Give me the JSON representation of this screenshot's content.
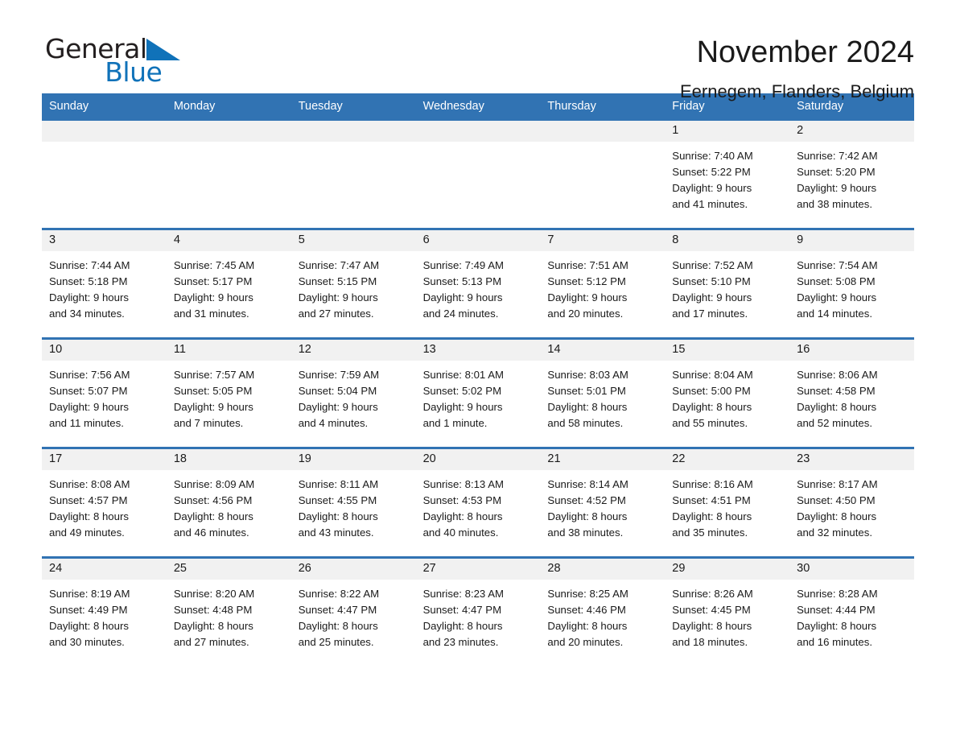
{
  "brand": {
    "name_part1": "General",
    "name_part2": "Blue",
    "accent_color": "#1072b9",
    "triangle_icon": "brand-triangle-icon"
  },
  "header": {
    "title": "November 2024",
    "subtitle": "Eernegem, Flanders, Belgium"
  },
  "calendar": {
    "header_bg": "#3173b3",
    "row_divider_color": "#3173b3",
    "daynum_band_bg": "#f1f1f1",
    "weekdays": [
      "Sunday",
      "Monday",
      "Tuesday",
      "Wednesday",
      "Thursday",
      "Friday",
      "Saturday"
    ],
    "weeks": [
      [
        {
          "day": "",
          "sunrise": "",
          "sunset": "",
          "daylight_line1": "",
          "daylight_line2": ""
        },
        {
          "day": "",
          "sunrise": "",
          "sunset": "",
          "daylight_line1": "",
          "daylight_line2": ""
        },
        {
          "day": "",
          "sunrise": "",
          "sunset": "",
          "daylight_line1": "",
          "daylight_line2": ""
        },
        {
          "day": "",
          "sunrise": "",
          "sunset": "",
          "daylight_line1": "",
          "daylight_line2": ""
        },
        {
          "day": "",
          "sunrise": "",
          "sunset": "",
          "daylight_line1": "",
          "daylight_line2": ""
        },
        {
          "day": "1",
          "sunrise": "Sunrise: 7:40 AM",
          "sunset": "Sunset: 5:22 PM",
          "daylight_line1": "Daylight: 9 hours",
          "daylight_line2": "and 41 minutes."
        },
        {
          "day": "2",
          "sunrise": "Sunrise: 7:42 AM",
          "sunset": "Sunset: 5:20 PM",
          "daylight_line1": "Daylight: 9 hours",
          "daylight_line2": "and 38 minutes."
        }
      ],
      [
        {
          "day": "3",
          "sunrise": "Sunrise: 7:44 AM",
          "sunset": "Sunset: 5:18 PM",
          "daylight_line1": "Daylight: 9 hours",
          "daylight_line2": "and 34 minutes."
        },
        {
          "day": "4",
          "sunrise": "Sunrise: 7:45 AM",
          "sunset": "Sunset: 5:17 PM",
          "daylight_line1": "Daylight: 9 hours",
          "daylight_line2": "and 31 minutes."
        },
        {
          "day": "5",
          "sunrise": "Sunrise: 7:47 AM",
          "sunset": "Sunset: 5:15 PM",
          "daylight_line1": "Daylight: 9 hours",
          "daylight_line2": "and 27 minutes."
        },
        {
          "day": "6",
          "sunrise": "Sunrise: 7:49 AM",
          "sunset": "Sunset: 5:13 PM",
          "daylight_line1": "Daylight: 9 hours",
          "daylight_line2": "and 24 minutes."
        },
        {
          "day": "7",
          "sunrise": "Sunrise: 7:51 AM",
          "sunset": "Sunset: 5:12 PM",
          "daylight_line1": "Daylight: 9 hours",
          "daylight_line2": "and 20 minutes."
        },
        {
          "day": "8",
          "sunrise": "Sunrise: 7:52 AM",
          "sunset": "Sunset: 5:10 PM",
          "daylight_line1": "Daylight: 9 hours",
          "daylight_line2": "and 17 minutes."
        },
        {
          "day": "9",
          "sunrise": "Sunrise: 7:54 AM",
          "sunset": "Sunset: 5:08 PM",
          "daylight_line1": "Daylight: 9 hours",
          "daylight_line2": "and 14 minutes."
        }
      ],
      [
        {
          "day": "10",
          "sunrise": "Sunrise: 7:56 AM",
          "sunset": "Sunset: 5:07 PM",
          "daylight_line1": "Daylight: 9 hours",
          "daylight_line2": "and 11 minutes."
        },
        {
          "day": "11",
          "sunrise": "Sunrise: 7:57 AM",
          "sunset": "Sunset: 5:05 PM",
          "daylight_line1": "Daylight: 9 hours",
          "daylight_line2": "and 7 minutes."
        },
        {
          "day": "12",
          "sunrise": "Sunrise: 7:59 AM",
          "sunset": "Sunset: 5:04 PM",
          "daylight_line1": "Daylight: 9 hours",
          "daylight_line2": "and 4 minutes."
        },
        {
          "day": "13",
          "sunrise": "Sunrise: 8:01 AM",
          "sunset": "Sunset: 5:02 PM",
          "daylight_line1": "Daylight: 9 hours",
          "daylight_line2": "and 1 minute."
        },
        {
          "day": "14",
          "sunrise": "Sunrise: 8:03 AM",
          "sunset": "Sunset: 5:01 PM",
          "daylight_line1": "Daylight: 8 hours",
          "daylight_line2": "and 58 minutes."
        },
        {
          "day": "15",
          "sunrise": "Sunrise: 8:04 AM",
          "sunset": "Sunset: 5:00 PM",
          "daylight_line1": "Daylight: 8 hours",
          "daylight_line2": "and 55 minutes."
        },
        {
          "day": "16",
          "sunrise": "Sunrise: 8:06 AM",
          "sunset": "Sunset: 4:58 PM",
          "daylight_line1": "Daylight: 8 hours",
          "daylight_line2": "and 52 minutes."
        }
      ],
      [
        {
          "day": "17",
          "sunrise": "Sunrise: 8:08 AM",
          "sunset": "Sunset: 4:57 PM",
          "daylight_line1": "Daylight: 8 hours",
          "daylight_line2": "and 49 minutes."
        },
        {
          "day": "18",
          "sunrise": "Sunrise: 8:09 AM",
          "sunset": "Sunset: 4:56 PM",
          "daylight_line1": "Daylight: 8 hours",
          "daylight_line2": "and 46 minutes."
        },
        {
          "day": "19",
          "sunrise": "Sunrise: 8:11 AM",
          "sunset": "Sunset: 4:55 PM",
          "daylight_line1": "Daylight: 8 hours",
          "daylight_line2": "and 43 minutes."
        },
        {
          "day": "20",
          "sunrise": "Sunrise: 8:13 AM",
          "sunset": "Sunset: 4:53 PM",
          "daylight_line1": "Daylight: 8 hours",
          "daylight_line2": "and 40 minutes."
        },
        {
          "day": "21",
          "sunrise": "Sunrise: 8:14 AM",
          "sunset": "Sunset: 4:52 PM",
          "daylight_line1": "Daylight: 8 hours",
          "daylight_line2": "and 38 minutes."
        },
        {
          "day": "22",
          "sunrise": "Sunrise: 8:16 AM",
          "sunset": "Sunset: 4:51 PM",
          "daylight_line1": "Daylight: 8 hours",
          "daylight_line2": "and 35 minutes."
        },
        {
          "day": "23",
          "sunrise": "Sunrise: 8:17 AM",
          "sunset": "Sunset: 4:50 PM",
          "daylight_line1": "Daylight: 8 hours",
          "daylight_line2": "and 32 minutes."
        }
      ],
      [
        {
          "day": "24",
          "sunrise": "Sunrise: 8:19 AM",
          "sunset": "Sunset: 4:49 PM",
          "daylight_line1": "Daylight: 8 hours",
          "daylight_line2": "and 30 minutes."
        },
        {
          "day": "25",
          "sunrise": "Sunrise: 8:20 AM",
          "sunset": "Sunset: 4:48 PM",
          "daylight_line1": "Daylight: 8 hours",
          "daylight_line2": "and 27 minutes."
        },
        {
          "day": "26",
          "sunrise": "Sunrise: 8:22 AM",
          "sunset": "Sunset: 4:47 PM",
          "daylight_line1": "Daylight: 8 hours",
          "daylight_line2": "and 25 minutes."
        },
        {
          "day": "27",
          "sunrise": "Sunrise: 8:23 AM",
          "sunset": "Sunset: 4:47 PM",
          "daylight_line1": "Daylight: 8 hours",
          "daylight_line2": "and 23 minutes."
        },
        {
          "day": "28",
          "sunrise": "Sunrise: 8:25 AM",
          "sunset": "Sunset: 4:46 PM",
          "daylight_line1": "Daylight: 8 hours",
          "daylight_line2": "and 20 minutes."
        },
        {
          "day": "29",
          "sunrise": "Sunrise: 8:26 AM",
          "sunset": "Sunset: 4:45 PM",
          "daylight_line1": "Daylight: 8 hours",
          "daylight_line2": "and 18 minutes."
        },
        {
          "day": "30",
          "sunrise": "Sunrise: 8:28 AM",
          "sunset": "Sunset: 4:44 PM",
          "daylight_line1": "Daylight: 8 hours",
          "daylight_line2": "and 16 minutes."
        }
      ]
    ]
  }
}
